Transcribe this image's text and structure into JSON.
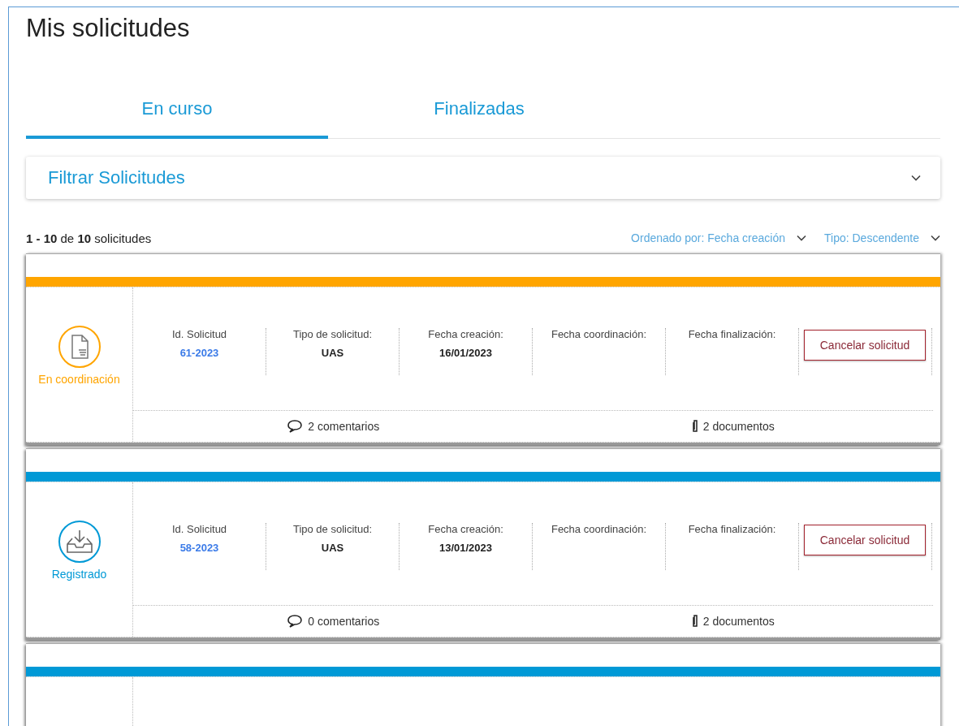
{
  "page": {
    "title": "Mis solicitudes"
  },
  "tabs": [
    {
      "label": "En curso",
      "selected": true
    },
    {
      "label": "Finalizadas",
      "selected": false
    }
  ],
  "filter": {
    "title": "Filtrar Solicitudes",
    "expanded": false
  },
  "summary": {
    "text": "**1 - 10** de **10** solicitudes",
    "sort_by": "Ordenado por: Fecha creación",
    "sort_type": "Tipo: Descendente"
  },
  "requests": [
    {
      "status": "En coordinación",
      "kind": "document",
      "color": "#ffa500",
      "fields": [
        {
          "label": "Id. Solicitud",
          "value": "61-2023",
          "kind": "link"
        },
        {
          "label": "Tipo de solicitud:",
          "value": "UAS",
          "kind": "text"
        },
        {
          "label": "Fecha creación:",
          "value": "16/01/2023",
          "kind": "text"
        },
        {
          "label": "Fecha coordinación:"
        },
        {
          "label": "Fecha finalización:"
        }
      ],
      "action": "Cancelar solicitud",
      "comments": "2 comentarios",
      "documents": "2 documentos"
    },
    {
      "status": "Registrado",
      "kind": "inbox",
      "color": "#0099d6",
      "fields": [
        {
          "label": "Id. Solicitud",
          "value": "58-2023",
          "kind": "link"
        },
        {
          "label": "Tipo de solicitud:",
          "value": "UAS",
          "kind": "text"
        },
        {
          "label": "Fecha creación:",
          "value": "13/01/2023",
          "kind": "text"
        },
        {
          "label": "Fecha coordinación:"
        },
        {
          "label": "Fecha finalización:"
        }
      ],
      "action": "Cancelar solicitud",
      "comments": "0 comentarios",
      "documents": "2 documentos"
    },
    {
      "color": "#0099d6"
    }
  ]
}
